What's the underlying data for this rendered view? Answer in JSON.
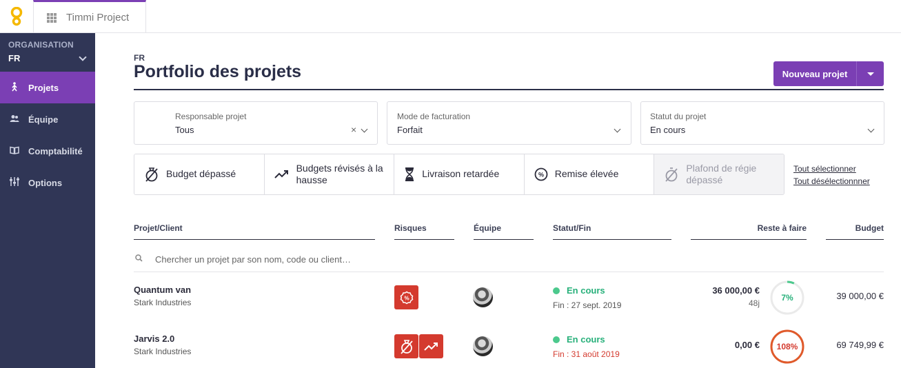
{
  "app": {
    "tab_label": "Timmi Project"
  },
  "sidebar": {
    "org_label": "ORGANISATION",
    "org_value": "FR",
    "items": [
      {
        "label": "Projets",
        "icon": "person-walk-icon",
        "active": true
      },
      {
        "label": "Équipe",
        "icon": "team-icon",
        "active": false
      },
      {
        "label": "Comptabilité",
        "icon": "book-icon",
        "active": false
      },
      {
        "label": "Options",
        "icon": "sliders-icon",
        "active": false
      }
    ]
  },
  "header": {
    "breadcrumb": "FR",
    "title": "Portfolio des projets",
    "new_button": "Nouveau projet"
  },
  "filters": {
    "owner": {
      "label": "Responsable projet",
      "value": "Tous"
    },
    "billing": {
      "label": "Mode de facturation",
      "value": "Forfait"
    },
    "status": {
      "label": "Statut du projet",
      "value": "En cours"
    }
  },
  "risks": [
    {
      "label": "Budget dépassé",
      "icon": "budget-exceeded-icon",
      "enabled": true
    },
    {
      "label": "Budgets révisés à la hausse",
      "icon": "trend-up-icon",
      "enabled": true
    },
    {
      "label": "Livraison retardée",
      "icon": "hourglass-icon",
      "enabled": true
    },
    {
      "label": "Remise élevée",
      "icon": "discount-icon",
      "enabled": true
    },
    {
      "label": "Plafond de régie dépassé",
      "icon": "ceiling-exceeded-icon",
      "enabled": false
    }
  ],
  "selection": {
    "select_all": "Tout sélectionner",
    "deselect_all": "Tout désélectionnner"
  },
  "table": {
    "columns": {
      "project": "Projet/Client",
      "risks": "Risques",
      "team": "Équipe",
      "status": "Statut/Fin",
      "remaining": "Reste à faire",
      "budget": "Budget"
    },
    "search_placeholder": "Chercher un projet par son nom, code ou client…",
    "rows": [
      {
        "name": "Quantum van",
        "client": "Stark Industries",
        "risk_icons": [
          "discount-icon"
        ],
        "status": "En cours",
        "end": "Fin : 27 sept. 2019",
        "end_late": false,
        "remaining": "36 000,00 €",
        "remaining_days": "48j",
        "progress_label": "7%",
        "progress": 0.07,
        "progress_color": "#4cc98d",
        "budget": "39 000,00 €"
      },
      {
        "name": "Jarvis 2.0",
        "client": "Stark Industries",
        "risk_icons": [
          "budget-exceeded-icon",
          "trend-up-icon"
        ],
        "status": "En cours",
        "end": "Fin : 31 août 2019",
        "end_late": true,
        "remaining": "0,00 €",
        "remaining_days": "",
        "progress_label": "108%",
        "progress": 1.08,
        "progress_color": "#e05a2b",
        "budget": "69 749,99 €"
      }
    ]
  }
}
